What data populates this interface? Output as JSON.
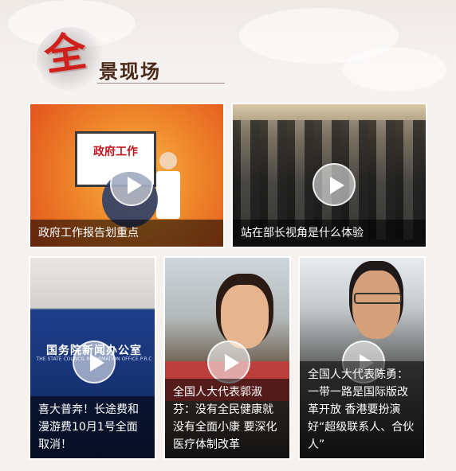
{
  "section": {
    "title_char": "全",
    "title_rest": "景现场"
  },
  "cards": [
    {
      "caption": "政府工作报告划重点",
      "inner_text": "政府工作"
    },
    {
      "caption": "站在部长视角是什么体验"
    },
    {
      "caption": "喜大普奔！长途费和漫游费10月1号全面取消！",
      "banner": "国务院新闻办公室",
      "banner_sub": "THE STATE COUNCIL INFORMATION OFFICE.P.R.C"
    },
    {
      "caption": "全国人大代表郭淑芬：没有全民健康就没有全面小康 要深化医疗体制改革"
    },
    {
      "caption": "全国人大代表陈勇：一带一路是国际版改革开放 香港要扮演好“超级联系人、合伙人”"
    }
  ],
  "colors": {
    "accent": "#d0201c"
  }
}
